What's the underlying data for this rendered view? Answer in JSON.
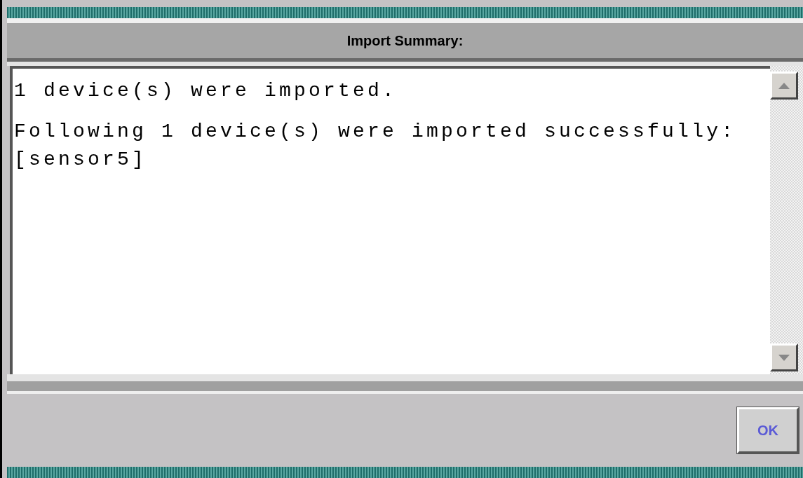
{
  "dialog": {
    "title": "Import Summary:"
  },
  "summary": {
    "paragraphs": [
      [
        "1 device(s) were imported."
      ],
      [
        "Following 1 device(s) were imported successfully:",
        "[sensor5]"
      ]
    ]
  },
  "buttons": [
    {
      "label": "OK"
    }
  ]
}
